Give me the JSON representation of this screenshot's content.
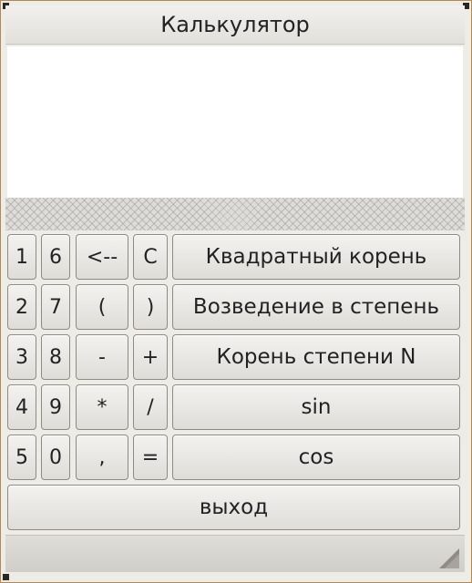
{
  "window": {
    "title": "Калькулятор"
  },
  "display": {
    "value": ""
  },
  "keys": {
    "k1": "1",
    "k6": "6",
    "backspace": "<--",
    "clear": "C",
    "sqrt": "Квадратный корень",
    "k2": "2",
    "k7": "7",
    "lparen": "(",
    "rparen": ")",
    "power": "Возведение в степень",
    "k3": "3",
    "k8": "8",
    "minus": "-",
    "plus": "+",
    "nthroot": "Корень степени N",
    "k4": "4",
    "k9": "9",
    "multiply": "*",
    "divide": "/",
    "sin": "sin",
    "k5": "5",
    "k0": "0",
    "comma": ",",
    "equals": "=",
    "cos": "cos",
    "exit": "выход"
  },
  "icons": {
    "resize_grip": "resize-grip-icon"
  }
}
